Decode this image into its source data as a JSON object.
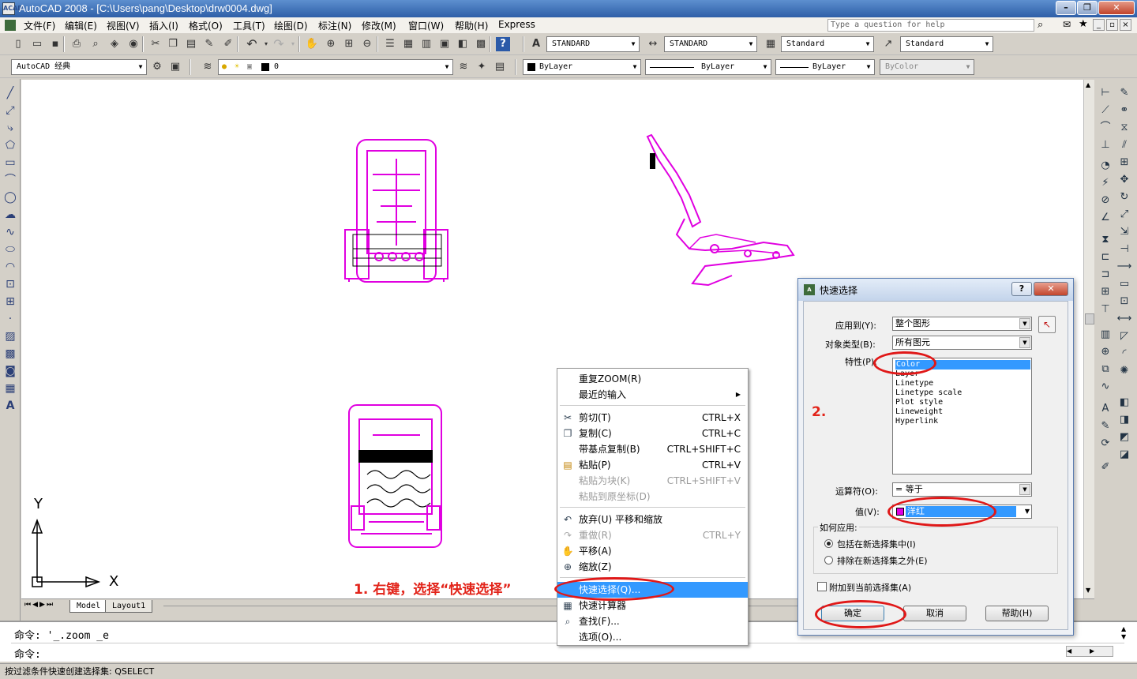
{
  "window": {
    "title": "AutoCAD 2008 - [C:\\Users\\pang\\Desktop\\drw0004.dwg]",
    "logo_text": "ACAD"
  },
  "menu": [
    "文件(F)",
    "编辑(E)",
    "视图(V)",
    "插入(I)",
    "格式(O)",
    "工具(T)",
    "绘图(D)",
    "标注(N)",
    "修改(M)",
    "窗口(W)",
    "帮助(H)",
    "Express"
  ],
  "help": {
    "placeholder": "Type a question for help"
  },
  "styles": {
    "text_style": "STANDARD",
    "dim_style": "STANDARD",
    "table_style": "Standard",
    "mleader_style": "Standard"
  },
  "workspace": "AutoCAD 经典",
  "layer": {
    "current": "0"
  },
  "properties": {
    "color": "ByLayer",
    "linetype": "ByLayer",
    "lineweight": "ByLayer",
    "plotstyle": "ByColor"
  },
  "tabs": {
    "model": "Model",
    "layout": "Layout1"
  },
  "ucs": {
    "x": "X",
    "y": "Y"
  },
  "command": {
    "history": "命令: '_.zoom _e",
    "prompt": "命令:"
  },
  "status": {
    "text": "按过滤条件快速创建选择集:  QSELECT"
  },
  "context_menu": {
    "items": [
      {
        "label": "重复ZOOM(R)",
        "submenu": false
      },
      {
        "label": "最近的输入",
        "submenu": true
      },
      {
        "label": "剪切(T)",
        "shortcut": "CTRL+X",
        "icon": "cut-icon"
      },
      {
        "label": "复制(C)",
        "shortcut": "CTRL+C",
        "icon": "copy-icon"
      },
      {
        "label": "带基点复制(B)",
        "shortcut": "CTRL+SHIFT+C"
      },
      {
        "label": "粘贴(P)",
        "shortcut": "CTRL+V",
        "icon": "paste-icon"
      },
      {
        "label": "粘贴为块(K)",
        "shortcut": "CTRL+SHIFT+V",
        "disabled": true
      },
      {
        "label": "粘贴到原坐标(D)",
        "disabled": true
      },
      {
        "label": "放弃(U) 平移和缩放",
        "icon": "undo-icon"
      },
      {
        "label": "重做(R)",
        "shortcut": "CTRL+Y",
        "disabled": true,
        "icon": "redo-icon"
      },
      {
        "label": "平移(A)",
        "icon": "pan-icon"
      },
      {
        "label": "缩放(Z)",
        "icon": "zoom-icon"
      },
      {
        "label": "快速选择(Q)...",
        "highlighted": true,
        "icon": "quick-select-icon"
      },
      {
        "label": "快速计算器",
        "icon": "calculator-icon"
      },
      {
        "label": "查找(F)...",
        "icon": "find-icon"
      },
      {
        "label": "选项(O)..."
      }
    ]
  },
  "dialog": {
    "title": "快速选择",
    "apply_to": {
      "label": "应用到(Y):",
      "value": "整个图形"
    },
    "object_type": {
      "label": "对象类型(B):",
      "value": "所有图元"
    },
    "properties_label": "特性(P):",
    "properties": [
      "Color",
      "Layer",
      "Linetype",
      "Linetype scale",
      "Plot style",
      "Lineweight",
      "Hyperlink"
    ],
    "selected_property": "Color",
    "operator": {
      "label": "运算符(O):",
      "value": "= 等于"
    },
    "value": {
      "label": "值(V):",
      "value": "洋红",
      "swatch": "#e000e0"
    },
    "how_to_apply": {
      "label": "如何应用:",
      "include": "包括在新选择集中(I)",
      "exclude": "排除在新选择集之外(E)",
      "selected": "include"
    },
    "append": {
      "label": "附加到当前选择集(A)",
      "checked": false
    },
    "buttons": {
      "ok": "确定",
      "cancel": "取消",
      "help": "帮助(H)"
    }
  },
  "annotations": {
    "step1": "1. 右键，选择“快速选择”",
    "step2": "2."
  },
  "colors": {
    "drawing": "#e000e0",
    "highlight": "#3399ff",
    "annotation": "#e2241a"
  }
}
